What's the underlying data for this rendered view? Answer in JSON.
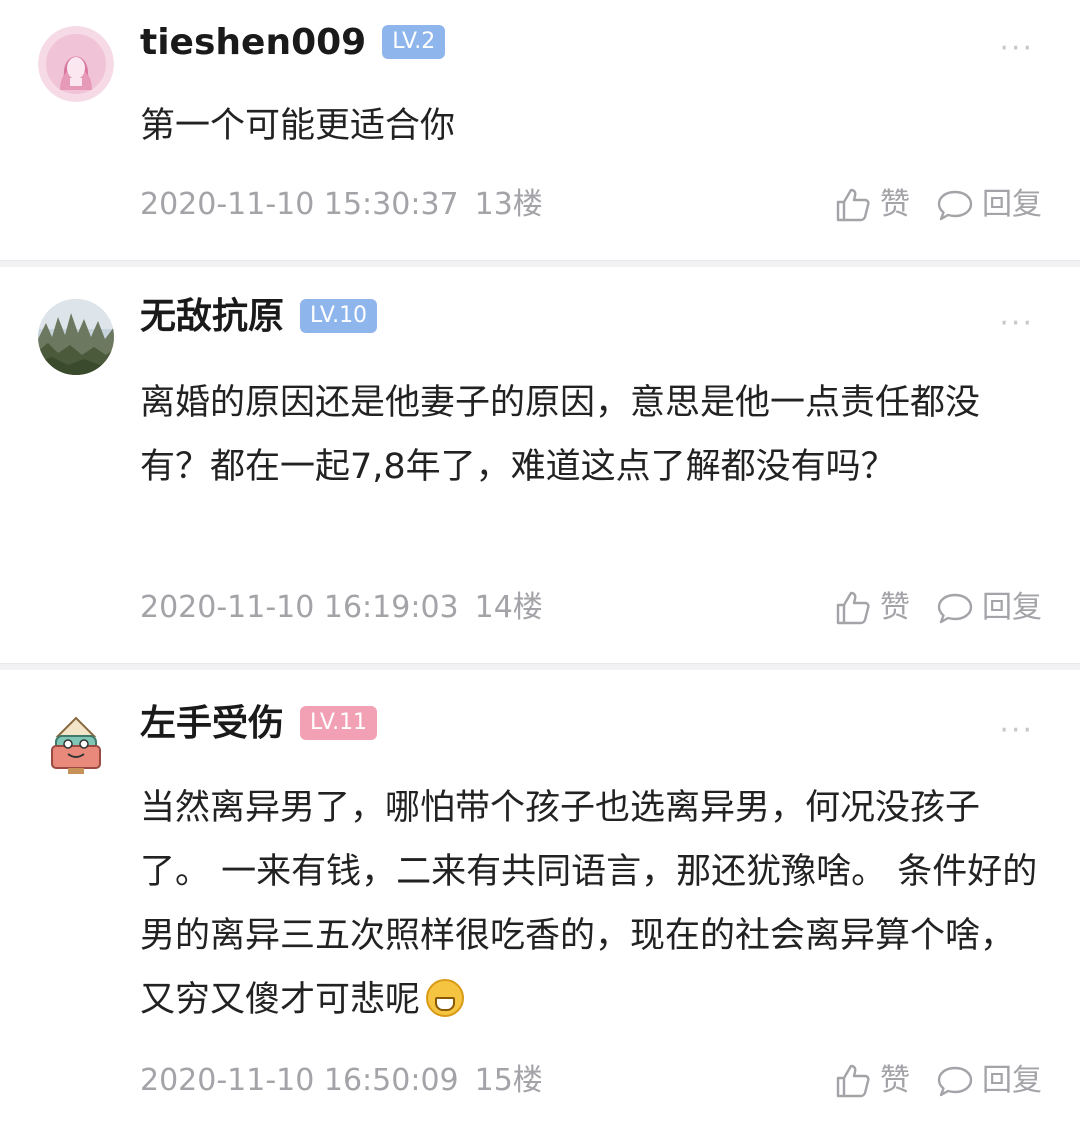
{
  "comments": [
    {
      "username": "tieshen009",
      "level": "LV.2",
      "level_color": "#8fb6ec",
      "avatar_icon": "pink-girl-avatar-icon",
      "content": "第一个可能更适合你",
      "timestamp": "2020-11-10 15:30:37",
      "floor": "13楼",
      "like_label": "赞",
      "reply_label": "回复"
    },
    {
      "username": "无敌抗原",
      "level": "LV.10",
      "level_color": "#8fb6ec",
      "avatar_icon": "mountain-landscape-avatar-icon",
      "content": "离婚的原因还是他妻子的原因，意思是他一点责任都没有？都在一起7,8年了，难道这点了解都没有吗？",
      "timestamp": "2020-11-10 16:19:03",
      "floor": "14楼",
      "like_label": "赞",
      "reply_label": "回复"
    },
    {
      "username": "左手受伤",
      "level": "LV.11",
      "level_color": "#f2a0b4",
      "avatar_icon": "cartoon-character-avatar-icon",
      "content": "当然离异男了，哪怕带个孩子也选离异男，何况没孩子了。 一来有钱，二来有共同语言，那还犹豫啥。 条件好的男的离异三五次照样很吃香的，现在的社会离异算个啥，又穷又傻才可悲呢",
      "emoji": "grinning-face-emoji",
      "timestamp": "2020-11-10 16:50:09",
      "floor": "15楼",
      "like_label": "赞",
      "reply_label": "回复"
    }
  ],
  "more_glyph": "···",
  "colors": {
    "meta_text": "#a3a3a8",
    "divider": "#f2f2f4"
  }
}
